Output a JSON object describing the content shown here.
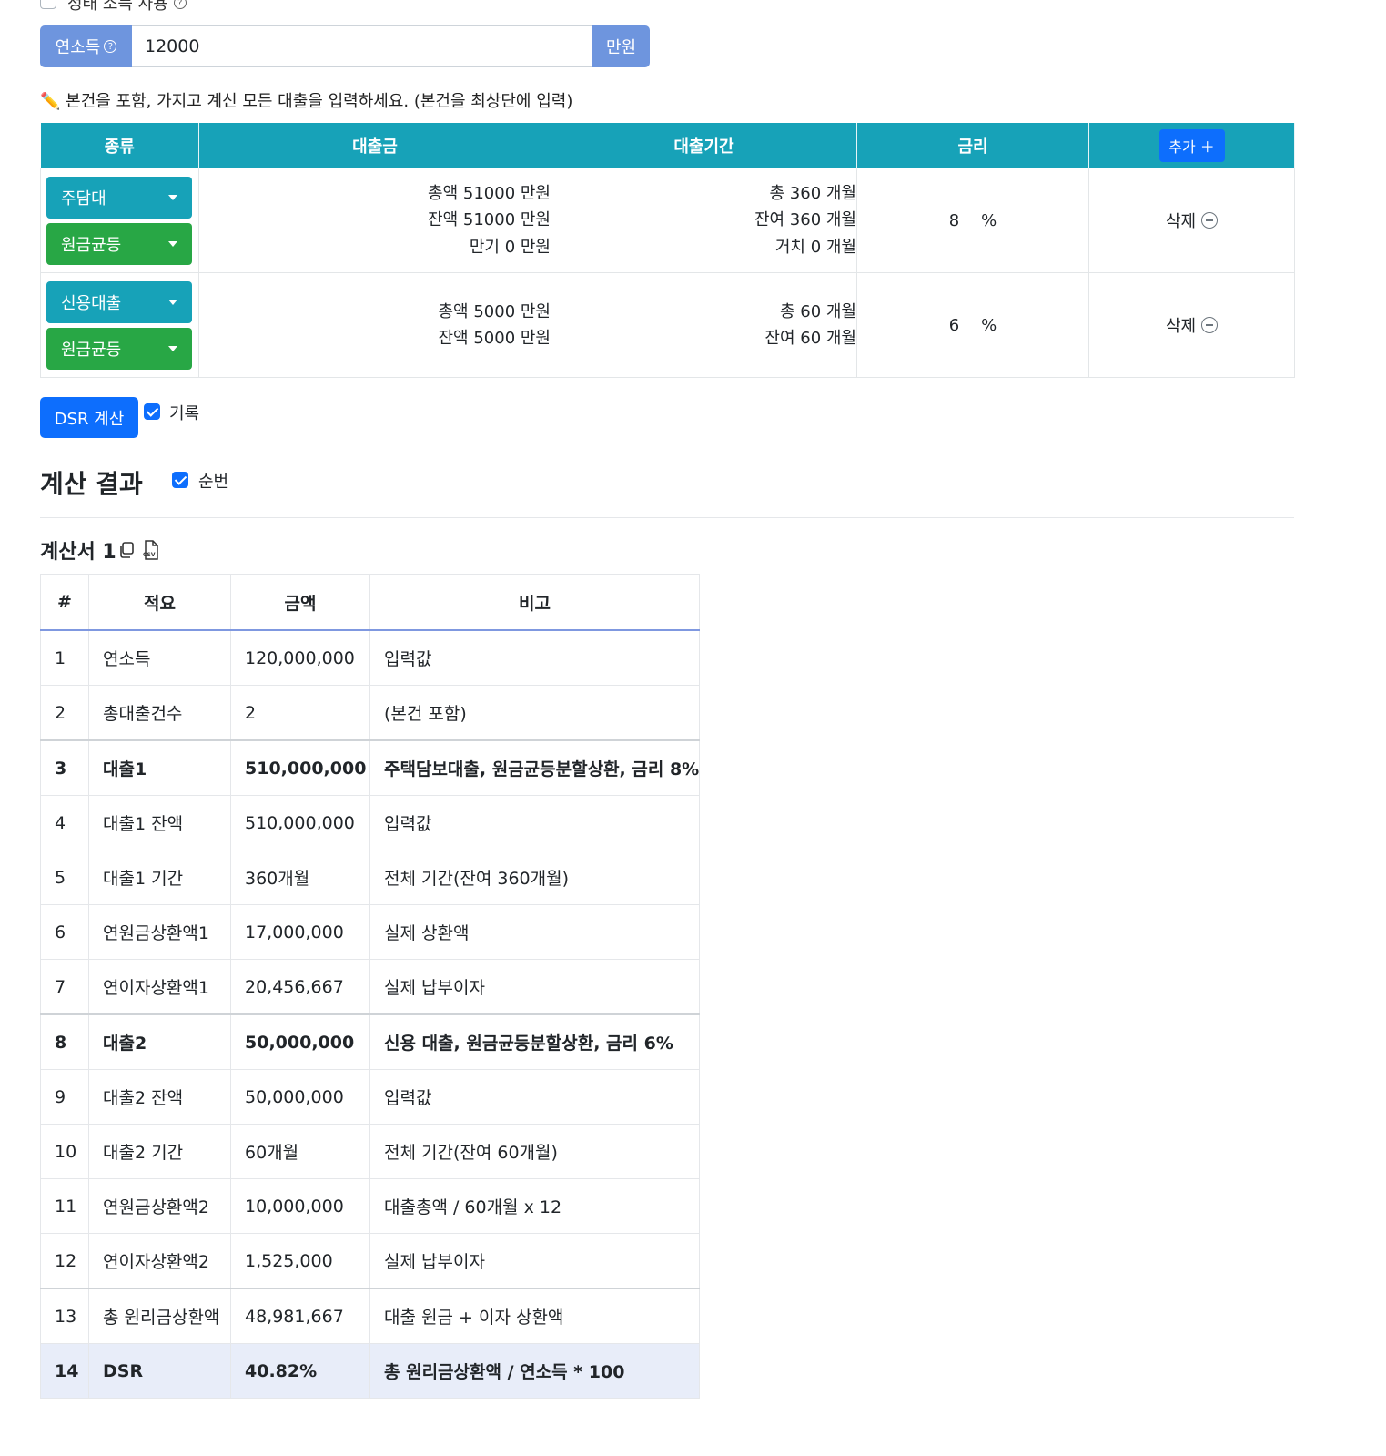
{
  "top_checkbox_label": "정태 소득 사용",
  "income": {
    "label": "연소득",
    "value": "12000",
    "unit": "만원"
  },
  "note": "✏️ 본건을 포함, 가지고 계신 모든 대출을 입력하세요. (본건을 최상단에 입력)",
  "loans_table": {
    "headers": [
      "종류",
      "대출금",
      "대출기간",
      "금리"
    ],
    "add_label": "추가 ＋",
    "delete_label": "삭제",
    "rows": [
      {
        "type": "주담대",
        "method": "원금균등",
        "amount_lines": [
          "총액 51000 만원",
          "잔액 51000 만원",
          "만기 0 만원"
        ],
        "period_lines": [
          "총 360 개월",
          "잔여 360 개월",
          "거치 0 개월"
        ],
        "rate": "8",
        "rate_unit": "%"
      },
      {
        "type": "신용대출",
        "method": "원금균등",
        "amount_lines": [
          "총액 5000 만원",
          "잔액 5000 만원"
        ],
        "period_lines": [
          "총 60 개월",
          "잔여 60 개월"
        ],
        "rate": "6",
        "rate_unit": "%"
      }
    ]
  },
  "calc_button": "DSR 계산",
  "record_label": "기록",
  "result_title": "계산 결과",
  "order_label": "순번",
  "sheet_title": "계산서 1",
  "csv_label": "CSV",
  "result_table": {
    "headers": [
      "#",
      "적요",
      "금액",
      "비고"
    ],
    "rows": [
      [
        "1",
        "연소득",
        "120,000,000",
        "입력값"
      ],
      [
        "2",
        "총대출건수",
        "2",
        "(본건 포함)"
      ],
      [
        "3",
        "대출1",
        "510,000,000",
        "주택담보대출, 원금균등분할상환, 금리 8%"
      ],
      [
        "4",
        "대출1 잔액",
        "510,000,000",
        "입력값"
      ],
      [
        "5",
        "대출1 기간",
        "360개월",
        "전체 기간(잔여 360개월)"
      ],
      [
        "6",
        "연원금상환액1",
        "17,000,000",
        "실제 상환액"
      ],
      [
        "7",
        "연이자상환액1",
        "20,456,667",
        "실제 납부이자"
      ],
      [
        "8",
        "대출2",
        "50,000,000",
        "신용 대출, 원금균등분할상환, 금리 6%"
      ],
      [
        "9",
        "대출2 잔액",
        "50,000,000",
        "입력값"
      ],
      [
        "10",
        "대출2 기간",
        "60개월",
        "전체 기간(잔여 60개월)"
      ],
      [
        "11",
        "연원금상환액2",
        "10,000,000",
        "대출총액 / 60개월 x 12"
      ],
      [
        "12",
        "연이자상환액2",
        "1,525,000",
        "실제 납부이자"
      ],
      [
        "13",
        "총 원리금상환액",
        "48,981,667",
        "대출 원금 + 이자 상환액"
      ],
      [
        "14",
        "DSR",
        "40.82%",
        "총 원리금상환액 / 연소득 * 100"
      ]
    ]
  },
  "colors": {
    "primary": "#0d6efd",
    "teal": "#17a2b8",
    "green": "#28a745",
    "income_addon": "#6e95de",
    "dsr_highlight": "#e8edf9"
  }
}
